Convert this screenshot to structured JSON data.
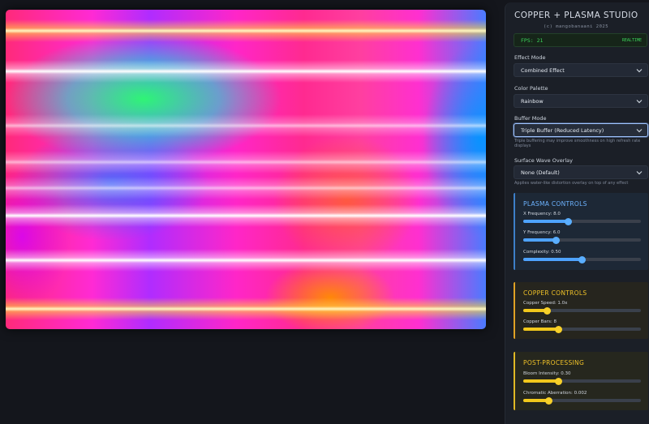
{
  "app": {
    "title": "COPPER + PLASMA STUDIO",
    "subtitle": "(c) mangobanaani 2025"
  },
  "fps": {
    "text": "FPS: 21",
    "mode": "REALTIME"
  },
  "controls": {
    "effect_mode": {
      "label": "Effect Mode",
      "value": "Combined Effect"
    },
    "color_palette": {
      "label": "Color Palette",
      "value": "Rainbow"
    },
    "buffer_mode": {
      "label": "Buffer Mode",
      "value": "Triple Buffer (Reduced Latency)",
      "help": "Triple buffering may improve smoothness on high refresh rate displays"
    },
    "surface_wave": {
      "label": "Surface Wave Overlay",
      "value": "None (Default)",
      "help": "Applies water-like distortion overlay on top of any effect"
    }
  },
  "plasma_controls": {
    "title": "PLASMA CONTROLS",
    "sliders": [
      {
        "label": "X Frequency: 8.0",
        "fraction": 0.38
      },
      {
        "label": "Y Frequency: 6.0",
        "fraction": 0.28
      },
      {
        "label": "Complexity: 0.50",
        "fraction": 0.5
      }
    ]
  },
  "copper_controls": {
    "title": "COPPER CONTROLS",
    "sliders": [
      {
        "label": "Copper Speed: 1.0x",
        "fraction": 0.2
      },
      {
        "label": "Copper Bars: 8",
        "fraction": 0.3
      }
    ]
  },
  "post_processing": {
    "title": "POST-PROCESSING",
    "sliders": [
      {
        "label": "Bloom Intensity: 0.30",
        "fraction": 0.3
      },
      {
        "label": "Chromatic Aberration: 0.002",
        "fraction": 0.22
      }
    ]
  },
  "colors": {
    "accent_blue": "#4ea3ff",
    "accent_gold": "#f2c81c",
    "fps_green": "#3bd35a",
    "panel_bg": "#1b1f27"
  }
}
